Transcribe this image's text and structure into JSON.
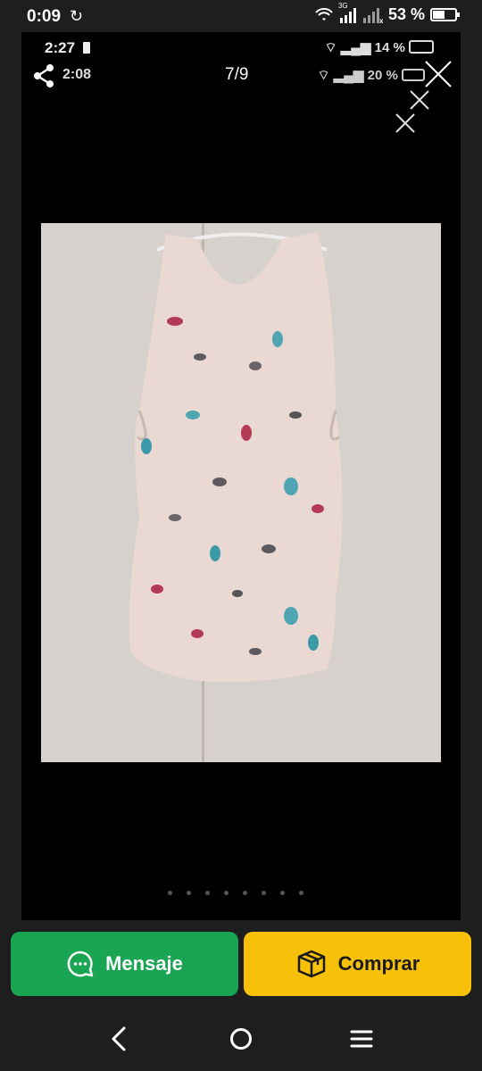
{
  "status_bar": {
    "time": "0:09",
    "network_tag": "3G",
    "battery": "53 %",
    "battery_level": 0.53
  },
  "viewer": {
    "inner_status_time": "2:27",
    "inner_status_battery": "14 %",
    "share_time": "2:08",
    "counter": "7/9",
    "inner_status2_battery": "20 %",
    "photo_alt": "sleeveless floral top"
  },
  "actions": {
    "message_label": "Mensaje",
    "buy_label": "Comprar"
  },
  "colors": {
    "message_bg": "#1aa552",
    "buy_bg": "#f7c10a"
  },
  "icons": {
    "message": "chat-bubble-icon",
    "buy": "box-icon",
    "nav_back": "back-icon",
    "nav_home": "home-icon",
    "nav_menu": "menu-icon"
  }
}
